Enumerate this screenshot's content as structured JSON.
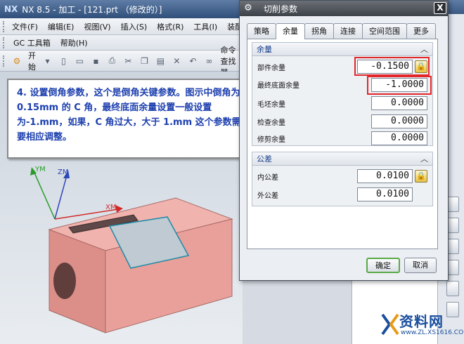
{
  "window": {
    "title": "NX 8.5 - 加工 - [121.prt （修改的）]",
    "logo": "NX"
  },
  "menubar": {
    "items": [
      "文件(F)",
      "编辑(E)",
      "视图(V)",
      "插入(S)",
      "格式(R)",
      "工具(I)",
      "装配(A)"
    ]
  },
  "menubar2": {
    "items": [
      "GC 工具箱",
      "帮助(H)"
    ]
  },
  "toolbar": {
    "start_label": "开始",
    "command_finder": "命令查找器"
  },
  "note": {
    "text": "4. 设置倒角参数，这个是倒角关键参数。图示中倒角为 0.15mm 的 C 角，最终底面余量设置一般设置为-1.mm，如果，C 角过大，大于 1.mm 这个参数需要相应调整。"
  },
  "axes": {
    "ym": "YM",
    "zm": "ZM",
    "xm": "XM"
  },
  "dialog": {
    "title": "切削参数",
    "close": "X",
    "tabs": [
      "策略",
      "余量",
      "拐角",
      "连接",
      "空间范围",
      "更多"
    ],
    "active_tab": "余量",
    "groups": {
      "allowance": {
        "title": "余量",
        "fields": [
          {
            "label": "部件余量",
            "value": "-0.1500",
            "locked": true,
            "highlighted": true
          },
          {
            "label": "最终底面余量",
            "value": "-1.0000",
            "locked": false,
            "highlighted": true
          },
          {
            "label": "毛坯余量",
            "value": "0.0000",
            "locked": false,
            "highlighted": false
          },
          {
            "label": "检查余量",
            "value": "0.0000",
            "locked": false,
            "highlighted": false
          },
          {
            "label": "修剪余量",
            "value": "0.0000",
            "locked": false,
            "highlighted": false
          }
        ]
      },
      "tolerance": {
        "title": "公差",
        "fields": [
          {
            "label": "内公差",
            "value": "0.0100",
            "locked": true
          },
          {
            "label": "外公差",
            "value": "0.0100",
            "locked": false
          }
        ]
      }
    },
    "ok_label": "确定",
    "cancel_label": "取消"
  },
  "watermark": {
    "main": "资料网",
    "sub": "www.ZL.XS1616.COM"
  },
  "colors": {
    "highlight": "#e3262a",
    "note_text": "#1c3fae",
    "part": "#e59a95",
    "ok_border": "#59a947"
  }
}
